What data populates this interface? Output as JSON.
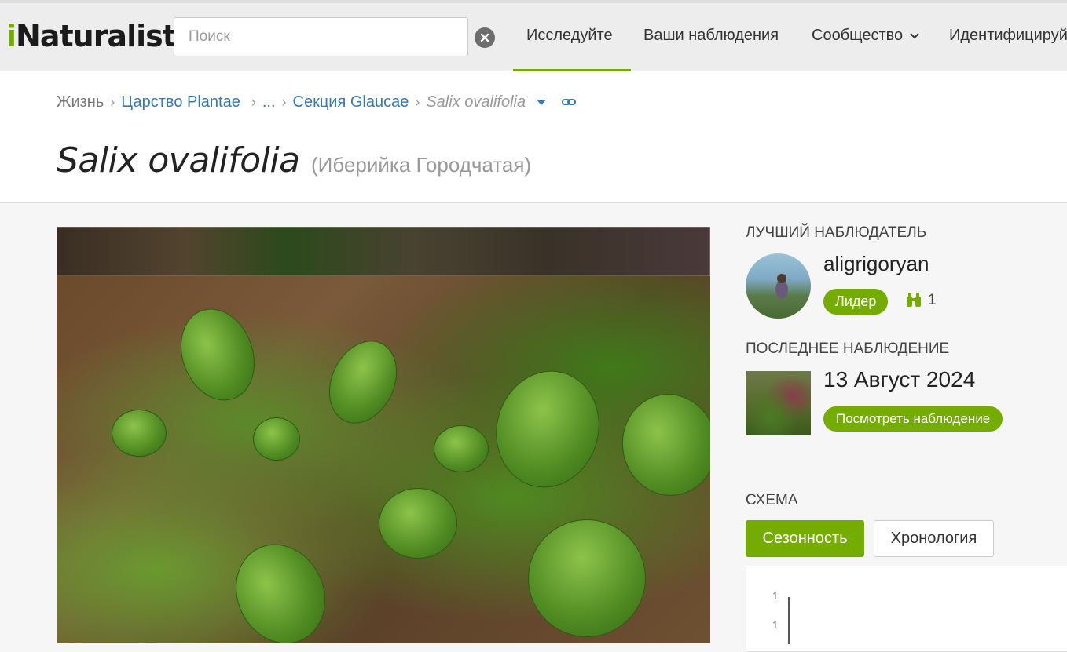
{
  "header": {
    "logo_first": "i",
    "logo_rest": "Naturalist",
    "search_placeholder": "Поиск",
    "nav": [
      "Исследуйте",
      "Ваши наблюдения",
      "Сообщество",
      "Идентифицируйте"
    ],
    "active_nav": "Исследуйте",
    "accent_color": "#74ac00"
  },
  "breadcrumb": {
    "items": [
      "Жизнь",
      "Царство Plantae",
      "...",
      "Секция Glaucae"
    ],
    "current": "Salix ovalifolia"
  },
  "taxon": {
    "scientific_name": "Salix ovalifolia",
    "common_name": "(Иберийка Городчатая)"
  },
  "top_observer": {
    "section_label": "ЛУЧШИЙ НАБЛЮДАТЕЛЬ",
    "username": "aligrigoryan",
    "badge": "Лидер",
    "observation_count": "1"
  },
  "last_observation": {
    "section_label": "ПОСЛЕДНЕЕ НАБЛЮДЕНИЕ",
    "date": "13 Август 2024",
    "button": "Посмотреть наблюдение"
  },
  "chart": {
    "section_label": "СХЕМА",
    "tabs": [
      "Сезонность",
      "Хронология"
    ],
    "active_tab": "Сезонность",
    "y_ticks": [
      "1",
      "1"
    ]
  }
}
